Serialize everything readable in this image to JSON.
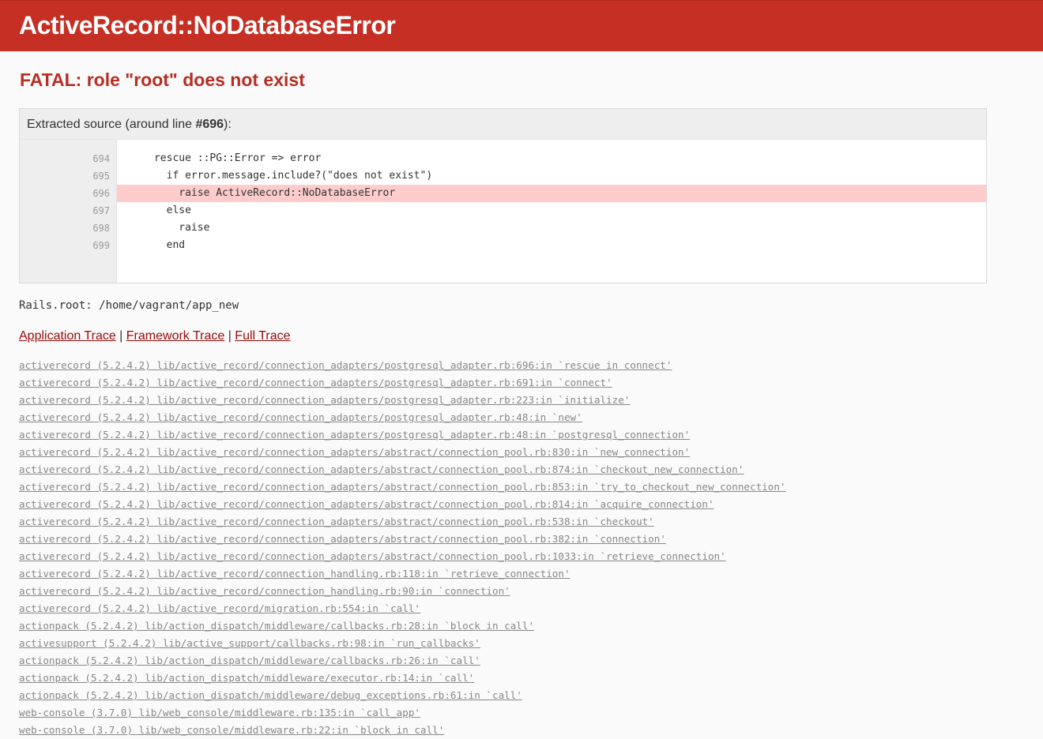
{
  "header": {
    "title": "ActiveRecord::NoDatabaseError"
  },
  "error_message": "FATAL: role \"root\" does not exist",
  "source": {
    "header_prefix": "Extracted source (around line ",
    "header_line": "#696",
    "header_suffix": "):",
    "lines": [
      {
        "num": "694",
        "code": "      rescue ::PG::Error => error"
      },
      {
        "num": "695",
        "code": "        if error.message.include?(\"does not exist\")"
      },
      {
        "num": "696",
        "code": "          raise ActiveRecord::NoDatabaseError"
      },
      {
        "num": "697",
        "code": "        else"
      },
      {
        "num": "698",
        "code": "          raise"
      },
      {
        "num": "699",
        "code": "        end"
      }
    ]
  },
  "rails_root": "Rails.root: /home/vagrant/app_new",
  "trace_nav": {
    "application": "Application Trace",
    "framework": "Framework Trace",
    "full": "Full Trace",
    "separator": " | "
  },
  "traces": [
    "activerecord (5.2.4.2) lib/active_record/connection_adapters/postgresql_adapter.rb:696:in `rescue in connect'",
    "activerecord (5.2.4.2) lib/active_record/connection_adapters/postgresql_adapter.rb:691:in `connect'",
    "activerecord (5.2.4.2) lib/active_record/connection_adapters/postgresql_adapter.rb:223:in `initialize'",
    "activerecord (5.2.4.2) lib/active_record/connection_adapters/postgresql_adapter.rb:48:in `new'",
    "activerecord (5.2.4.2) lib/active_record/connection_adapters/postgresql_adapter.rb:48:in `postgresql_connection'",
    "activerecord (5.2.4.2) lib/active_record/connection_adapters/abstract/connection_pool.rb:830:in `new_connection'",
    "activerecord (5.2.4.2) lib/active_record/connection_adapters/abstract/connection_pool.rb:874:in `checkout_new_connection'",
    "activerecord (5.2.4.2) lib/active_record/connection_adapters/abstract/connection_pool.rb:853:in `try_to_checkout_new_connection'",
    "activerecord (5.2.4.2) lib/active_record/connection_adapters/abstract/connection_pool.rb:814:in `acquire_connection'",
    "activerecord (5.2.4.2) lib/active_record/connection_adapters/abstract/connection_pool.rb:538:in `checkout'",
    "activerecord (5.2.4.2) lib/active_record/connection_adapters/abstract/connection_pool.rb:382:in `connection'",
    "activerecord (5.2.4.2) lib/active_record/connection_adapters/abstract/connection_pool.rb:1033:in `retrieve_connection'",
    "activerecord (5.2.4.2) lib/active_record/connection_handling.rb:118:in `retrieve_connection'",
    "activerecord (5.2.4.2) lib/active_record/connection_handling.rb:90:in `connection'",
    "activerecord (5.2.4.2) lib/active_record/migration.rb:554:in `call'",
    "actionpack (5.2.4.2) lib/action_dispatch/middleware/callbacks.rb:28:in `block in call'",
    "activesupport (5.2.4.2) lib/active_support/callbacks.rb:98:in `run_callbacks'",
    "actionpack (5.2.4.2) lib/action_dispatch/middleware/callbacks.rb:26:in `call'",
    "actionpack (5.2.4.2) lib/action_dispatch/middleware/executor.rb:14:in `call'",
    "actionpack (5.2.4.2) lib/action_dispatch/middleware/debug_exceptions.rb:61:in `call'",
    "web-console (3.7.0) lib/web_console/middleware.rb:135:in `call_app'",
    "web-console (3.7.0) lib/web_console/middleware.rb:22:in `block in call'"
  ]
}
